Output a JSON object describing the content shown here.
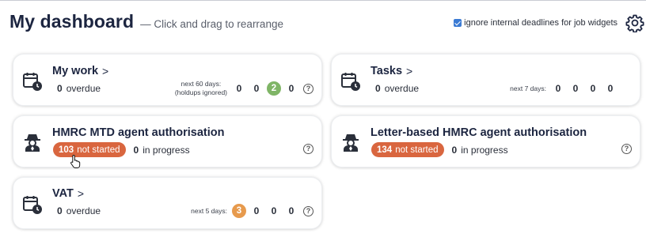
{
  "header": {
    "title": "My dashboard",
    "subtitle": "— Click and drag to rearrange"
  },
  "options": {
    "ignore_deadlines_label": "ignore internal deadlines for job widgets",
    "ignore_deadlines_checked": true
  },
  "colors": {
    "green": "#7fb566",
    "orange": "#e79a4d",
    "red_badge": "#d9663f",
    "checkbox_blue": "#3b7bd4"
  },
  "widgets": {
    "my_work": {
      "title": "My work",
      "chevron": ">",
      "overdue_count": "0",
      "overdue_label": "overdue",
      "next_label": "next 60 days:",
      "next_sublabel": "(holdups ignored)",
      "counts": [
        "0",
        "0",
        "2",
        "0"
      ],
      "icon": "calendar-clock-icon"
    },
    "tasks": {
      "title": "Tasks",
      "chevron": ">",
      "overdue_count": "0",
      "overdue_label": "overdue",
      "next_label": "next 7 days:",
      "counts": [
        "0",
        "0",
        "0",
        "0"
      ],
      "icon": "calendar-clock-icon"
    },
    "hmrc_mtd": {
      "title": "HMRC MTD agent authorisation",
      "not_started_count": "103",
      "not_started_label": "not started",
      "in_progress_count": "0",
      "in_progress_label": "in progress",
      "icon": "agent-spy-icon"
    },
    "letter_hmrc": {
      "title": "Letter-based HMRC agent authorisation",
      "not_started_count": "134",
      "not_started_label": "not started",
      "in_progress_count": "0",
      "in_progress_label": "in progress",
      "icon": "agent-spy-icon"
    },
    "vat": {
      "title": "VAT",
      "chevron": ">",
      "overdue_count": "0",
      "overdue_label": "overdue",
      "next_label": "next 5 days:",
      "counts": [
        "3",
        "0",
        "0",
        "0"
      ],
      "icon": "calendar-clock-icon"
    }
  },
  "help_glyph": "?"
}
